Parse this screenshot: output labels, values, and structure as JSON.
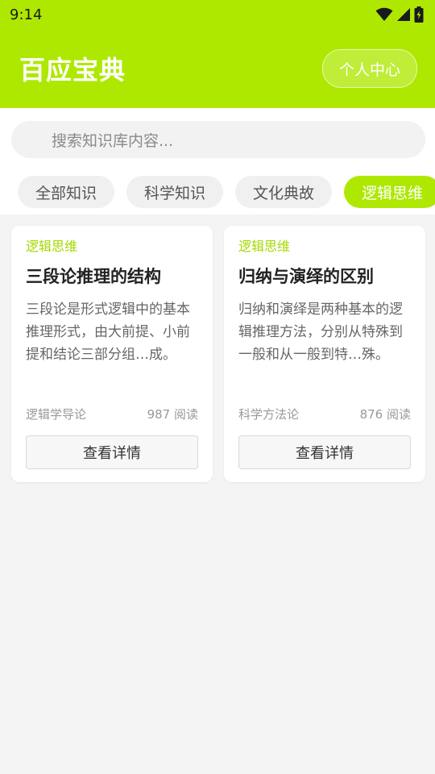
{
  "status_bar": {
    "time": "9:14"
  },
  "app_bar": {
    "title": "百应宝典",
    "profile_label": "个人中心"
  },
  "search": {
    "placeholder": "搜索知识库内容..."
  },
  "categories": [
    {
      "label": "全部知识",
      "active": false
    },
    {
      "label": "科学知识",
      "active": false
    },
    {
      "label": "文化典故",
      "active": false
    },
    {
      "label": "逻辑思维",
      "active": true
    }
  ],
  "cards": [
    {
      "category": "逻辑思维",
      "title": "三段论推理的结构",
      "description": "三段论是形式逻辑中的基本推理形式，由大前提、小前提和结论三部分组…成。",
      "source": "逻辑学导论",
      "reads": "987 阅读",
      "button_label": "查看详情"
    },
    {
      "category": "逻辑思维",
      "title": "归纳与演绎的区别",
      "description": "归纳和演绎是两种基本的逻辑推理方法，分别从特殊到一般和从一般到特…殊。",
      "source": "科学方法论",
      "reads": "876 阅读",
      "button_label": "查看详情"
    }
  ],
  "colors": {
    "accent": "#aee800",
    "category_text": "#a6d800"
  }
}
